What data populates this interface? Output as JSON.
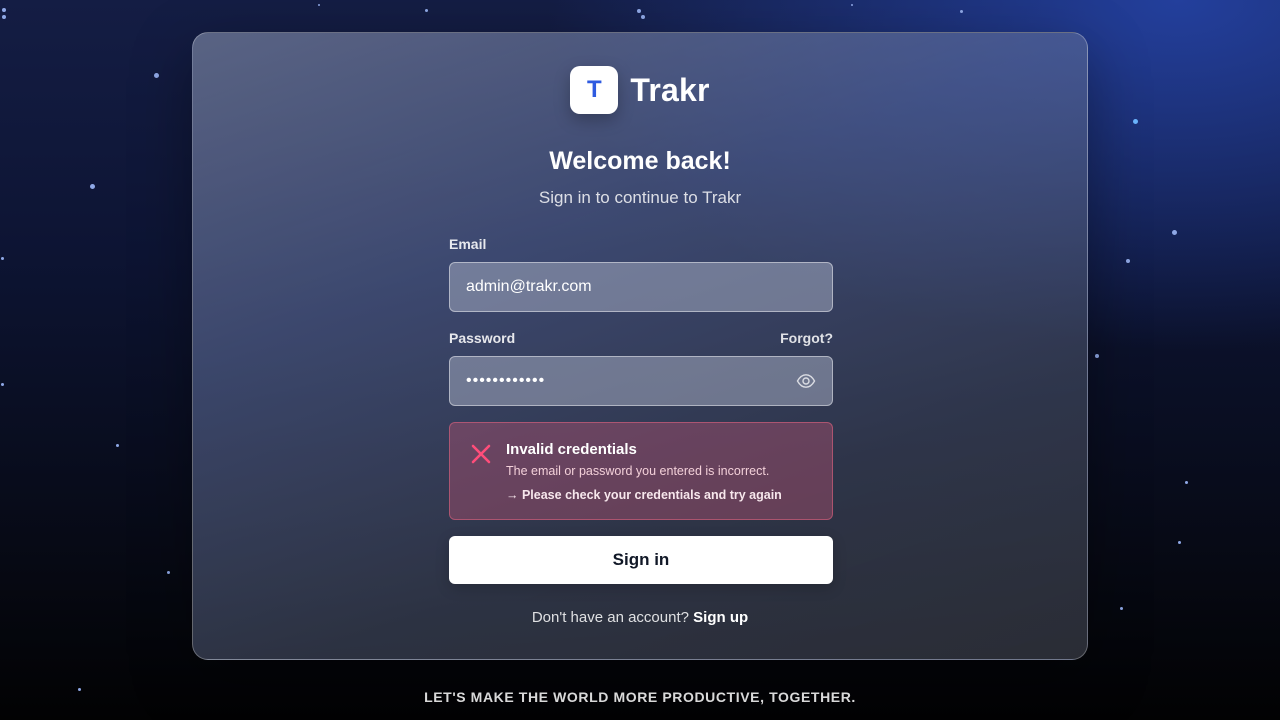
{
  "brand": {
    "logo_letter": "T",
    "name": "Trakr"
  },
  "heading": {
    "title": "Welcome back!",
    "subtitle": "Sign in to continue to Trakr"
  },
  "form": {
    "email_label": "Email",
    "email_value": "admin@trakr.com",
    "password_label": "Password",
    "forgot_label": "Forgot?",
    "password_value": "••••••••••••",
    "show_password_icon": "eye-icon"
  },
  "error": {
    "icon": "close-icon",
    "title": "Invalid credentials",
    "message": "The email or password you entered is incorrect.",
    "hint": "→ Please check your credentials and try again"
  },
  "actions": {
    "signin_label": "Sign in",
    "signup_prompt": "Don't have an account?",
    "signup_label": "Sign up"
  },
  "footer": {
    "tagline": "LET'S MAKE THE WORLD MORE PRODUCTIVE, TOGETHER."
  },
  "colors": {
    "accent": "#2f5be0",
    "error": "#ff4d7a",
    "button_bg": "#ffffff"
  }
}
